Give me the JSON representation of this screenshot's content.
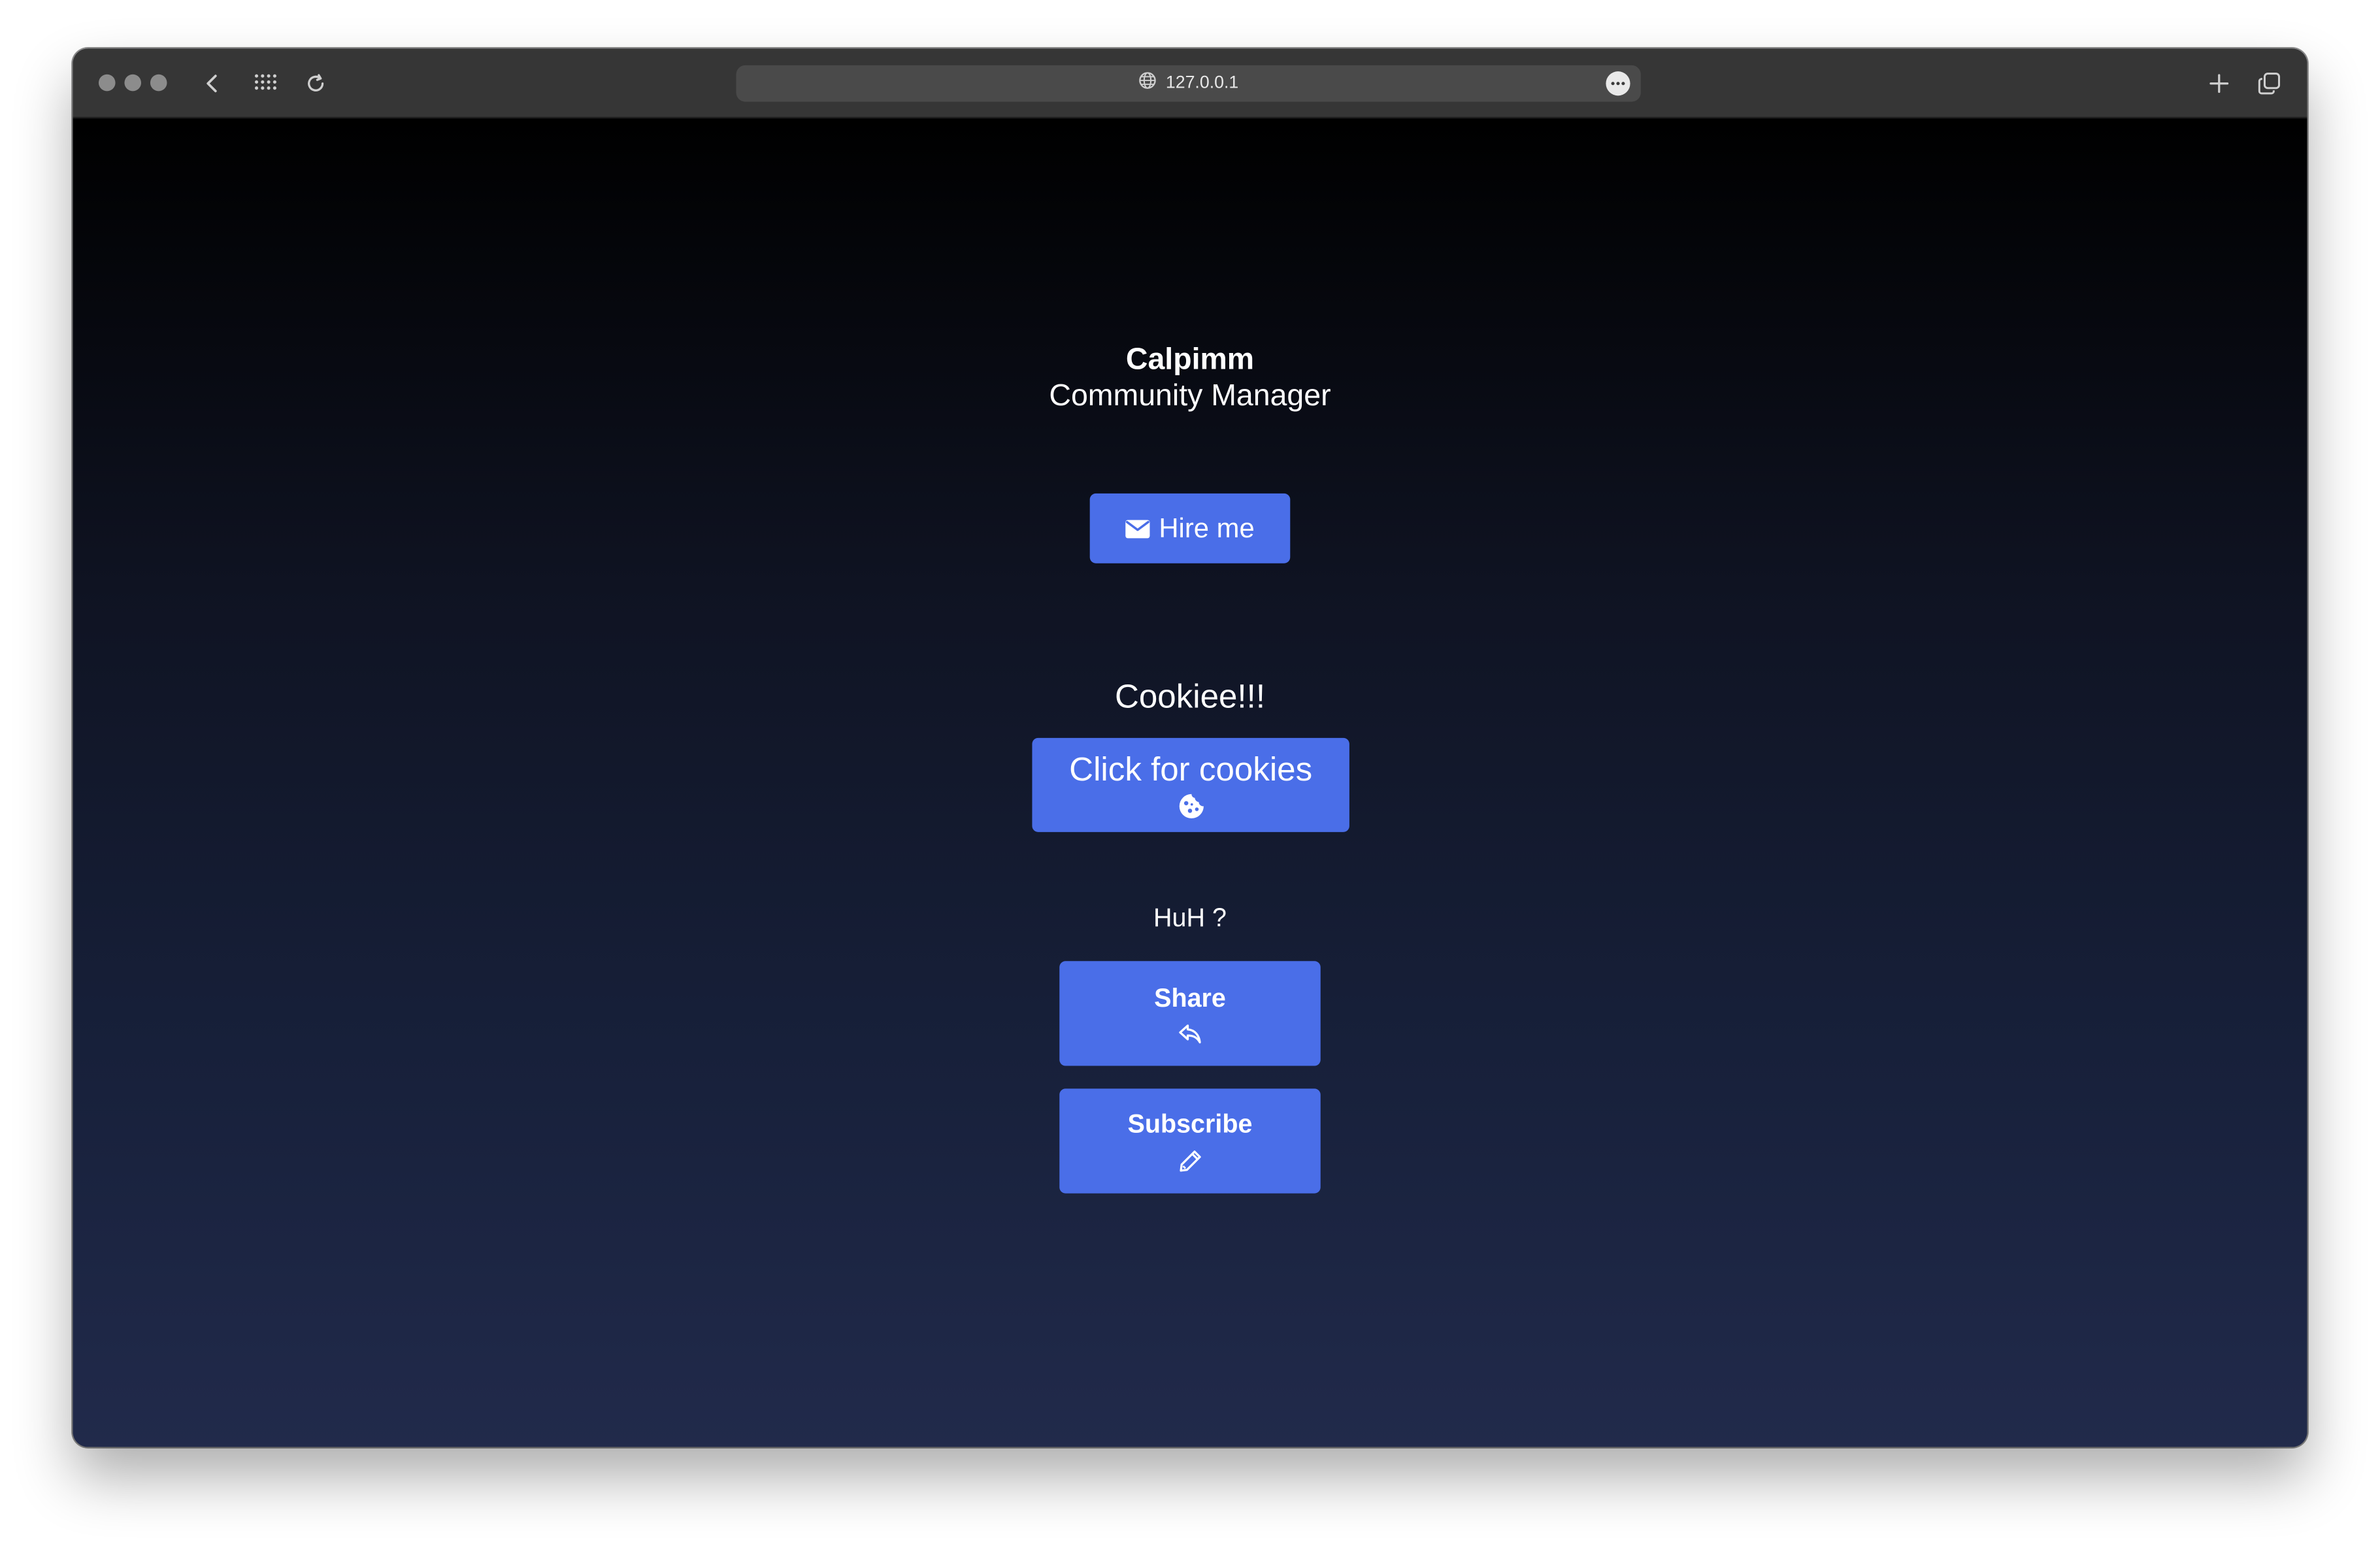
{
  "browser": {
    "url": "127.0.0.1",
    "icons": [
      "window-dots",
      "back-icon",
      "grid-icon",
      "reload-icon",
      "globe-icon",
      "more-icon",
      "plus-icon",
      "tabs-icon"
    ]
  },
  "profile": {
    "name": "Calpimm",
    "role": "Community Manager",
    "hire_label": "Hire me",
    "hire_icon": "envelope-icon"
  },
  "cookies": {
    "title": "Cookiee!!!",
    "button_label": "Click for cookies",
    "button_icon": "cookie-icon"
  },
  "actions": {
    "title": "HuH ?",
    "share_label": "Share",
    "share_icon": "share-icon",
    "subscribe_label": "Subscribe",
    "subscribe_icon": "pen-icon"
  },
  "colors": {
    "accent": "#4a6ee8",
    "background_top": "#000000",
    "background_bottom": "#212a4b",
    "titlebar": "#363636"
  }
}
